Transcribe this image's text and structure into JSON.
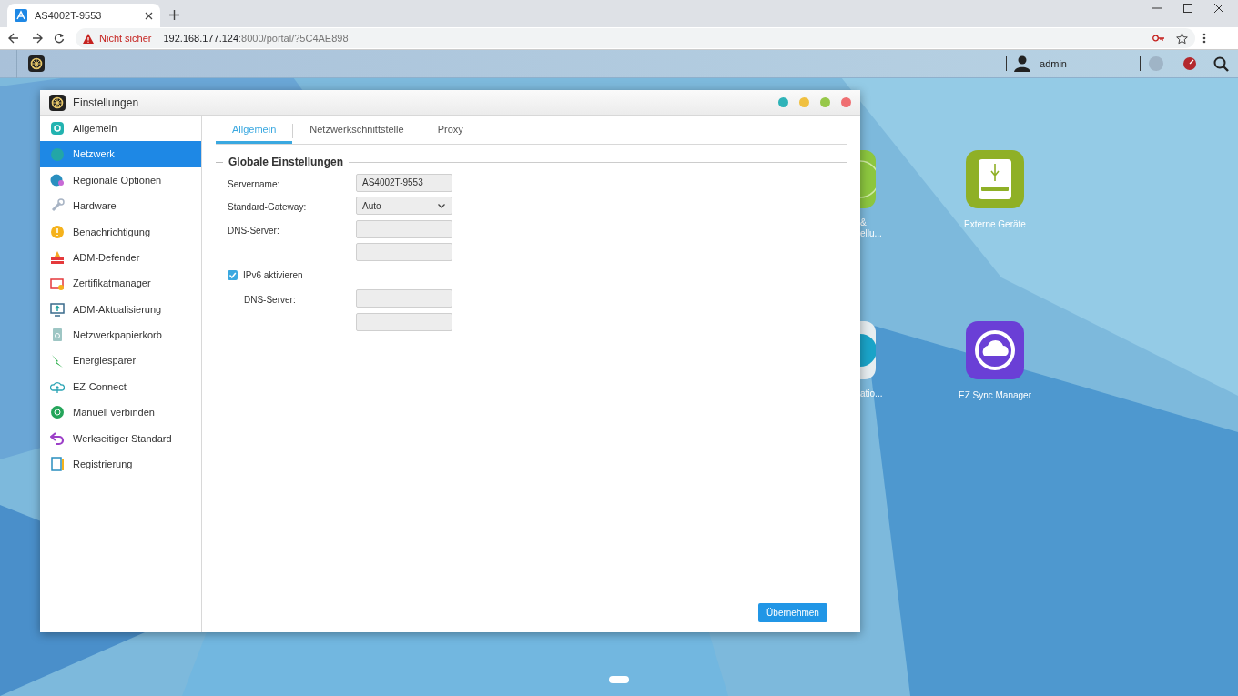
{
  "browser": {
    "tab_title": "AS4002T-9553",
    "security": "Nicht sicher",
    "url_host": "192.168.177.124",
    "url_path": ":8000/portal/?5C4AE898"
  },
  "taskbar": {
    "user": "admin"
  },
  "desktop_icons": [
    {
      "kind": "partial",
      "label_lines": [
        "&",
        "ellu..."
      ]
    },
    {
      "kind": "drive",
      "label_lines": [
        "Externe Geräte"
      ]
    },
    {
      "kind": "partial",
      "label_lines": [
        "atio..."
      ]
    },
    {
      "kind": "sync",
      "label_lines": [
        "EZ Sync Manager"
      ]
    }
  ],
  "window": {
    "title": "Einstellungen",
    "sidebar": [
      {
        "label": "Allgemein",
        "selected": false
      },
      {
        "label": "Netzwerk",
        "selected": true
      },
      {
        "label": "Regionale Optionen",
        "selected": false
      },
      {
        "label": "Hardware",
        "selected": false
      },
      {
        "label": "Benachrichtigung",
        "selected": false
      },
      {
        "label": "ADM-Defender",
        "selected": false
      },
      {
        "label": "Zertifikatmanager",
        "selected": false
      },
      {
        "label": "ADM-Aktualisierung",
        "selected": false
      },
      {
        "label": "Netzwerkpapierkorb",
        "selected": false
      },
      {
        "label": "Energiesparer",
        "selected": false
      },
      {
        "label": "EZ-Connect",
        "selected": false
      },
      {
        "label": "Manuell verbinden",
        "selected": false
      },
      {
        "label": "Werkseitiger Standard",
        "selected": false
      },
      {
        "label": "Registrierung",
        "selected": false
      }
    ],
    "tabs": [
      {
        "label": "Allgemein",
        "selected": true
      },
      {
        "label": "Netzwerkschnittstelle",
        "selected": false
      },
      {
        "label": "Proxy",
        "selected": false
      }
    ],
    "section_title": "Globale Einstellungen",
    "rows": [
      {
        "kind": "text",
        "label": "Servername:",
        "value": "AS4002T-9553"
      },
      {
        "kind": "select",
        "label": "Standard-Gateway:",
        "value": "Auto"
      },
      {
        "kind": "text",
        "label": "DNS-Server:"
      },
      {
        "kind": "text"
      },
      {
        "kind": "checkbox",
        "label": "IPv6 aktivieren",
        "checked": true,
        "children": [
          {
            "kind": "text",
            "label": "DNS-Server:"
          },
          {
            "kind": "text"
          }
        ]
      }
    ],
    "apply_button": "Übernehmen"
  }
}
